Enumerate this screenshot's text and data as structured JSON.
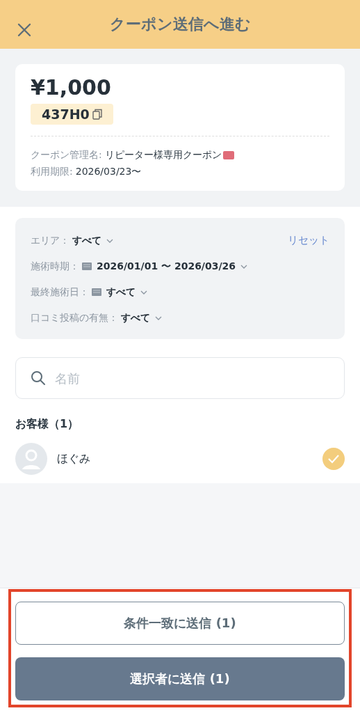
{
  "header": {
    "title": "クーポン送信へ進む"
  },
  "coupon": {
    "amount": "¥1,000",
    "code": "437H0",
    "name_label": "クーポン管理名:",
    "name": "リピーター様専用クーポン",
    "period_label": "利用期限:",
    "period": "2026/03/23〜"
  },
  "filters": {
    "reset": "リセット",
    "items": [
      {
        "label": "エリア：",
        "value": "すべて",
        "calendar": false
      },
      {
        "label": "施術時期：",
        "value": "2026/01/01 〜 2026/03/26",
        "calendar": true
      },
      {
        "label": "最終施術日：",
        "value": "すべて",
        "calendar": true
      },
      {
        "label": "口コミ投稿の有無：",
        "value": "すべて",
        "calendar": false
      }
    ]
  },
  "search": {
    "placeholder": "名前"
  },
  "customers": {
    "heading": "お客様（1）",
    "items": [
      {
        "name": "ほぐみ",
        "selected": true
      }
    ]
  },
  "buttons": [
    {
      "label": "条件一致に送信 (1)",
      "kind": "outline"
    },
    {
      "label": "選択者に送信 (1)",
      "kind": "primary"
    }
  ]
}
